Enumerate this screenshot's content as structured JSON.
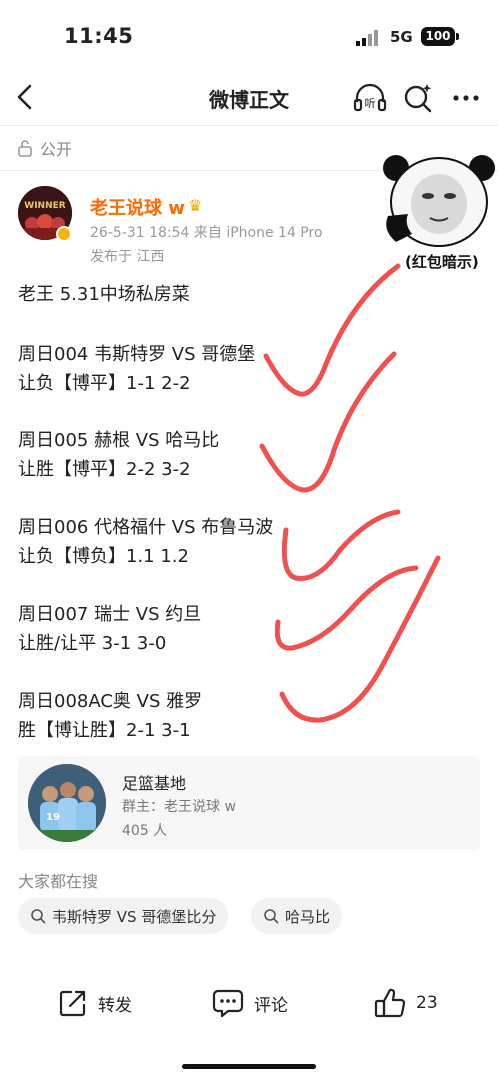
{
  "status_bar": {
    "time": "11:45",
    "network": "5G",
    "battery": "100"
  },
  "nav": {
    "title": "微博正文"
  },
  "post": {
    "visibility": "公开",
    "author": "老王说球 w",
    "time_device": "26-5-31 18:54  来自 iPhone 14 Pro",
    "location": "发布于 江西",
    "meme_caption": "(红包暗示)",
    "lines": [
      "老王 5.31中场私房菜",
      "周日004 韦斯特罗 VS 哥德堡",
      "让负【博平】1-1 2-2",
      "周日005 赫根 VS 哈马比",
      "让胜【博平】2-2 3-2",
      "周日006 代格福什 VS 布鲁马波",
      "让负【博负】1.1 1.2",
      "周日007 瑞士 VS 约旦",
      "让胜/让平 3-1 3-0",
      "周日008AC奥 VS 雅罗",
      "胜【博让胜】2-1 3-1"
    ]
  },
  "group": {
    "name": "足篮基地",
    "owner": "群主：老王说球 w",
    "members": "405 人"
  },
  "search": {
    "heading": "大家都在搜",
    "chips": [
      "韦斯特罗 VS 哥德堡比分",
      "哈马比"
    ]
  },
  "actions": {
    "repost": "转发",
    "comment": "评论",
    "like_count": "23"
  },
  "colors": {
    "author": "#ff6a00",
    "check_marks": "#f05050"
  }
}
